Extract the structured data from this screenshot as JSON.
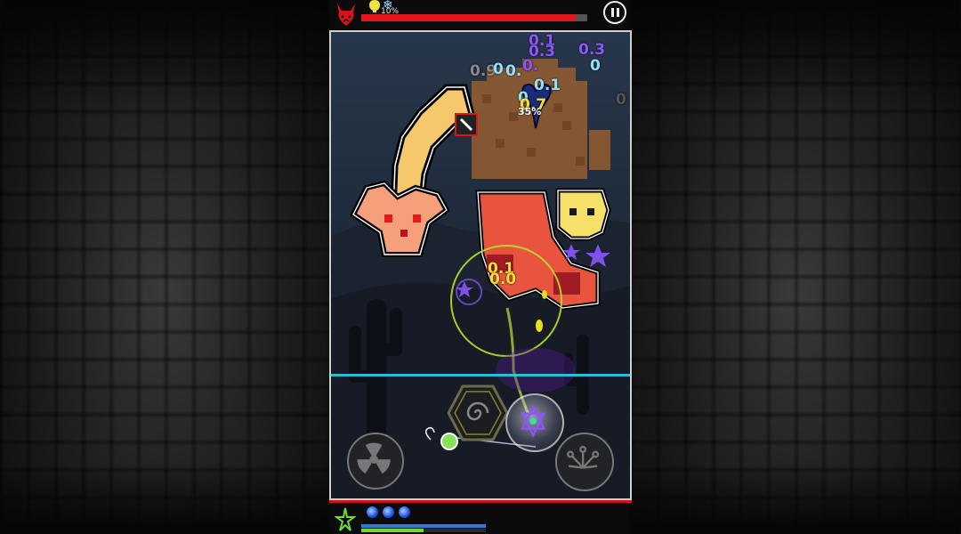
{
  "hud": {
    "boss_health_fraction": 0.95,
    "shield_percent_text": "10%",
    "pause_icon": "pause-icon",
    "boss_icon": "devil-head-icon",
    "shield_icon": "lightbulb-shield-icon",
    "frost_icon": "snowflake-icon"
  },
  "boss": {
    "name_icon": "pixel-dragon",
    "hit_percent_text": "35%"
  },
  "damage_numbers": [
    {
      "text": "0.1",
      "color": "#8c55ff"
    },
    {
      "text": "0.3",
      "color": "#8c55ff"
    },
    {
      "text": "0.3",
      "color": "#8c55ff"
    },
    {
      "text": "0",
      "color": "#8fe0ff"
    },
    {
      "text": "0.9",
      "color": "#8a8a8a"
    },
    {
      "text": "0",
      "color": "#8fe0ff"
    },
    {
      "text": "0.",
      "color": "#8fe0ff"
    },
    {
      "text": "0.",
      "color": "#8c55ff"
    },
    {
      "text": "0.1",
      "color": "#8fe0ff"
    },
    {
      "text": "0",
      "color": "#8fe0ff"
    },
    {
      "text": "0.7",
      "color": "#ffdd33"
    },
    {
      "text": "0.1",
      "color": "#ffdd33"
    },
    {
      "text": "0.0",
      "color": "#ffdd33"
    },
    {
      "text": "0",
      "color": "#555555"
    }
  ],
  "skills": [
    {
      "name": "radiation",
      "icon": "radiation-icon"
    },
    {
      "name": "spiral",
      "icon": "spiral-hexagon-icon"
    },
    {
      "name": "star-orb",
      "icon": "star-orb-icon"
    },
    {
      "name": "burst",
      "icon": "burst-icon"
    }
  ],
  "bottom": {
    "orbs": 3,
    "hero_icon": "green-star-hero-icon",
    "xp_fraction": 0.5
  },
  "colors": {
    "boss_bar": "#e2161c",
    "field_line": "#2ad0e6",
    "bottom_line": "#d2121a",
    "orb": "#1a4fe0"
  }
}
